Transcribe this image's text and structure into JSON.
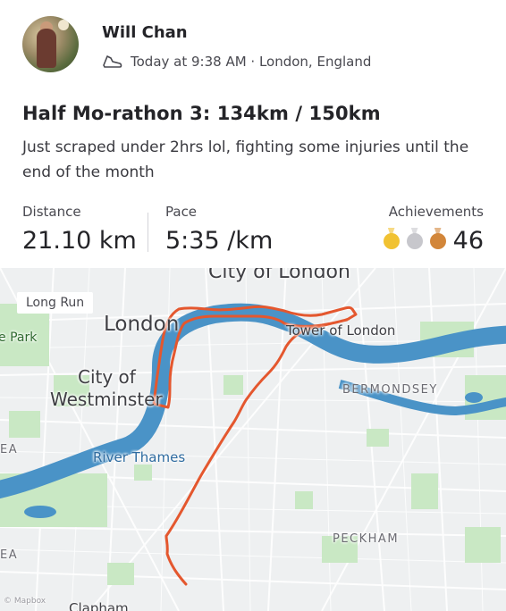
{
  "activity": {
    "athlete_name": "Will Chan",
    "timestamp": "Today at 9:38 AM · London, England",
    "activity_icon": "shoe-icon",
    "title": "Half Mo-rathon 3: 134km / 150km",
    "description": "Just scraped under 2hrs lol, fighting some injuries until the end of the month"
  },
  "stats": {
    "distance_label": "Distance",
    "distance_value": "21.10 km",
    "pace_label": "Pace",
    "pace_value": "5:35 /km",
    "achievements_label": "Achievements",
    "achievements_count": "46",
    "medal_icons": [
      "gold-medal-icon",
      "silver-medal-icon",
      "bronze-medal-icon"
    ]
  },
  "map": {
    "badge": "Long Run",
    "labels": {
      "city_of_london": "City of London",
      "london": "London",
      "tower_of_london": "Tower of London",
      "park": "e Park",
      "city_of_westminster_1": "City of",
      "city_of_westminster_2": "Westminster",
      "bermondsey": "BERMONDSEY",
      "river_thames": "River Thames",
      "ea_1": "EA",
      "peckham": "PECKHAM",
      "ea_2": "EA",
      "clapham": "Clapham",
      "copyright": "© Mapbox"
    },
    "route_color": "#e4572e",
    "water_color": "#4a93c7",
    "park_color": "#c9e8c4"
  }
}
